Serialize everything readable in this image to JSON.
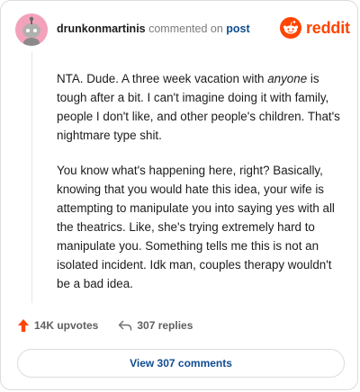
{
  "header": {
    "username": "drunkonmartinis",
    "action_text": "commented on",
    "post_link": "post",
    "logo_text": "reddit"
  },
  "comment": {
    "paragraph1_a": "NTA. Dude. A three week vacation with ",
    "paragraph1_em": "anyone",
    "paragraph1_b": " is tough after a bit. I can't imagine doing it with family, people I don't like, and other people's children. That's nightmare type shit.",
    "paragraph2": "You know what's happening here, right? Basically, knowing that you would hate this idea, your wife is attempting to manipulate you into saying yes with all the theatrics. Like, she's trying extremely hard to manipulate you. Something tells me this is not an isolated incident. Idk man, couples therapy wouldn't be a bad idea."
  },
  "actions": {
    "upvotes_label": "14K upvotes",
    "replies_label": "307 replies"
  },
  "footer": {
    "view_button": "View 307 comments"
  },
  "colors": {
    "brand": "#ff4500",
    "link": "#0f4c91",
    "avatar_bg": "#f3a2bb"
  },
  "icons": [
    "reddit-snoo-icon",
    "upvote-arrow-icon",
    "reply-arrow-icon"
  ]
}
